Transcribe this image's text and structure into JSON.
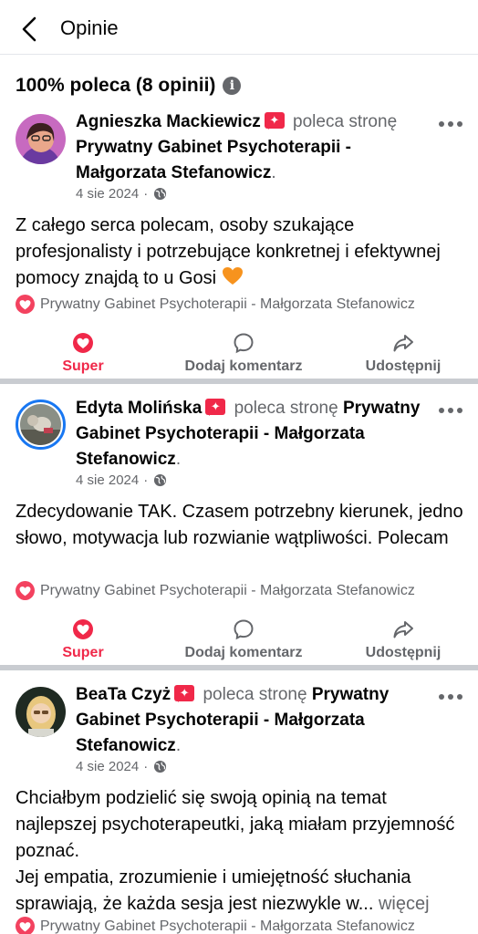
{
  "topbar": {
    "title": "Opinie"
  },
  "summary": {
    "text": "100% poleca (8 opinii)"
  },
  "reviews": [
    {
      "name": "Agnieszka Mackiewicz",
      "badge_icon": "recommend-badge-icon",
      "recommends": "poleca",
      "page_prefix": "stronę",
      "page": "Prywatny Gabinet Psychoterapii - Małgorzata Stefanowicz",
      "date": "4 sie 2024",
      "dot": "·",
      "text": "Z całego serca polecam, osoby szukające profesjonalisty i potrzebujące konkretnej i efektywnej pomocy znajdą to u Gosi",
      "page_tag": "Prywatny Gabinet Psychoterapii - Małgorzata Stefanowicz",
      "actions": {
        "react": "Super",
        "comment": "Dodaj komentarz",
        "share": "Udostępnij"
      }
    },
    {
      "name": "Edyta Molińska",
      "recommends": "poleca stronę",
      "page": "Prywatny Gabinet Psychoterapii - Małgorzata Stefanowicz",
      "date": "4 sie 2024",
      "dot": "·",
      "text": "Zdecydowanie TAK. Czasem potrzebny kierunek, jedno słowo, motywacja lub rozwianie wątpliwości. Polecam",
      "page_tag": "Prywatny Gabinet Psychoterapii - Małgorzata Stefanowicz",
      "actions": {
        "react": "Super",
        "comment": "Dodaj komentarz",
        "share": "Udostępnij"
      }
    },
    {
      "name": "BeaTa Czyż",
      "recommends": "poleca stronę",
      "page": "Prywatny Gabinet Psychoterapii - Małgorzata Stefanowicz",
      "date": "4 sie 2024",
      "dot": "·",
      "text_line1": "Chciałbym podzielić się swoją opinią na temat najlepszej psychoterapeutki, jaką miałam przyjemność poznać.",
      "text_line2": "Jej empatia, zrozumienie i umiejętność słuchania sprawiają, że każda sesja jest niezwykle w...",
      "more": "więcej",
      "page_tag": "Prywatny Gabinet Psychoterapii - Małgorzata Stefanowicz"
    }
  ],
  "colors": {
    "accent_red": "#f02849",
    "muted": "#65676b",
    "text": "#050505",
    "separator": "#c9ccd1"
  }
}
